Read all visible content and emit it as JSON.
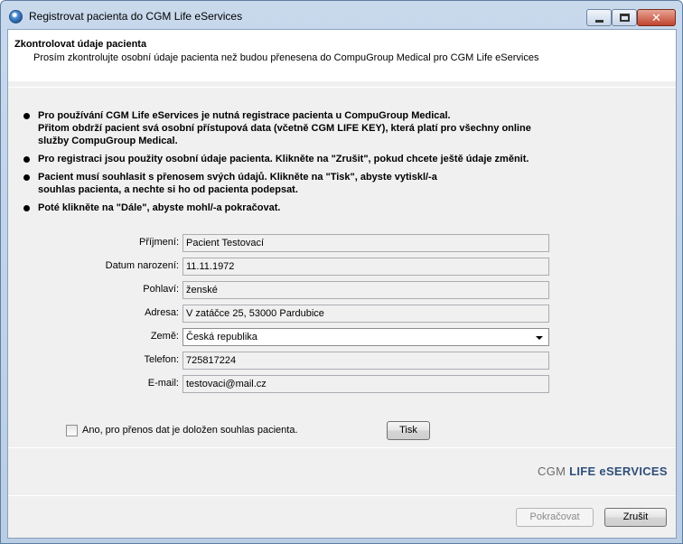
{
  "window": {
    "title": "Registrovat pacienta do CGM Life eServices",
    "close_glyph": "✕"
  },
  "header": {
    "title": "Zkontrolovat údaje pacienta",
    "subtitle": "Prosím zkontrolujte osobní údaje pacienta než budou přenesena do CompuGroup Medical pro CGM Life eServices"
  },
  "bullets": [
    {
      "lines": [
        "Pro používání CGM Life eServices je nutná registrace pacienta u CompuGroup Medical.",
        "Přitom obdrží pacient svá osobní přístupová data (včetně CGM LIFE KEY), která platí pro všechny online",
        "služby CompuGroup Medical."
      ]
    },
    {
      "lines": [
        "Pro registraci jsou použity osobní údaje pacienta. Klikněte na \"Zrušit\", pokud chcete ještě údaje změnit."
      ]
    },
    {
      "lines": [
        "Pacient musí souhlasit s přenosem svých údajů. Klikněte na \"Tisk\", abyste vytiskl/-a",
        "souhlas pacienta, a nechte si ho od pacienta podepsat."
      ]
    },
    {
      "lines": [
        "Poté klikněte na \"Dále\", abyste mohl/-a pokračovat."
      ]
    }
  ],
  "form": {
    "surname": {
      "label": "Příjmení:",
      "value": "Pacient Testovací"
    },
    "birthdate": {
      "label": "Datum narození:",
      "value": "11.11.1972"
    },
    "gender": {
      "label": "Pohlaví:",
      "value": "ženské"
    },
    "address": {
      "label": "Adresa:",
      "value": "V zatáčce 25, 53000 Pardubice"
    },
    "country": {
      "label": "Země:",
      "value": "Česká republika"
    },
    "phone": {
      "label": "Telefon:",
      "value": "725817224"
    },
    "email": {
      "label": "E-mail:",
      "value": "testovaci@mail.cz"
    }
  },
  "consent": {
    "label": "Ano, pro přenos dat je doložen souhlas pacienta.",
    "checked": false
  },
  "buttons": {
    "print": "Tisk",
    "next": "Pokračovat",
    "cancel": "Zrušit"
  },
  "logo": {
    "part1": "CGM ",
    "part2": "LIFE eSERVICES"
  },
  "colors": {
    "logo_gray": "#6b6b6b",
    "logo_blue": "#2f4f79"
  }
}
